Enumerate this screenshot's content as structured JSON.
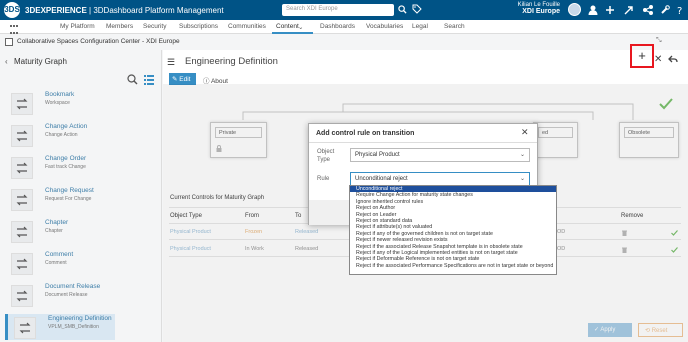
{
  "topbar": {
    "logo": "3DS",
    "brand_bold": "3DEXPERIENCE",
    "brand_rest": " | 3DDashboard  Platform Management",
    "search_placeholder": "Search XDI Europe",
    "user_name": "Kilian Le Fouille",
    "tenant": "XDI Europe"
  },
  "nav": {
    "items": [
      "My Platform",
      "Members",
      "Security",
      "Subscriptions",
      "Communities",
      "Content",
      "Dashboards",
      "Vocabularies",
      "Legal",
      "Search"
    ],
    "active": "Content"
  },
  "subheader": {
    "title": "Collaborative Spaces Configuration Center - XDI Europe"
  },
  "left": {
    "title": "Maturity Graph",
    "items": [
      {
        "name": "Bookmark",
        "desc": "Workspace"
      },
      {
        "name": "Change Action",
        "desc": "Change Action"
      },
      {
        "name": "Change Order",
        "desc": "Fast track Change"
      },
      {
        "name": "Change Request",
        "desc": "Request For Change"
      },
      {
        "name": "Chapter",
        "desc": "Chapter"
      },
      {
        "name": "Comment",
        "desc": "Comment"
      },
      {
        "name": "Document Release",
        "desc": "Document Release"
      },
      {
        "name": "Engineering Definition",
        "desc": "VPLM_SMB_Definition"
      }
    ]
  },
  "main": {
    "title": "Engineering Definition",
    "plus_label": "+",
    "close_label": "✕",
    "edit_label": "Edit",
    "about_label": "About",
    "nodes": {
      "private": "Private",
      "released": "ed",
      "obsolete": "Obsolete"
    },
    "controls_title": "Current Controls for Maturity Graph",
    "table": {
      "headers": [
        "Object Type",
        "From",
        "To",
        "Remove"
      ],
      "rows": [
        {
          "type": "Physical Product",
          "from": "Frozen",
          "to": "Released",
          "tail": "ROD"
        },
        {
          "type": "Physical Product",
          "from": "In Work",
          "to": "Released",
          "tail": "ROD"
        }
      ]
    },
    "apply_label": "Apply",
    "reset_label": "Reset"
  },
  "modal": {
    "title": "Add control rule on transition",
    "object_type_label": "Object Type",
    "object_type_value": "Physical Product",
    "rule_label": "Rule",
    "rule_value": "Unconditional reject",
    "options": [
      "Unconditional reject",
      "Require Change Action for maturity state changes",
      "Ignore inherited control rules",
      "Reject on Author",
      "Reject on Leader",
      "Reject on standard data",
      "Reject if attribute(s) not valuated",
      "Reject if any of the governed children is not on target state",
      "Reject if newer released revision exists",
      "Reject if the associated Release Snapshot template is in obsolete state",
      "Reject if any of the Logical implemented entities is not on target state",
      "Reject if Deformable Reference is not on target state",
      "Reject if the associated Performance Specifications are not in target state or beyond"
    ]
  },
  "colors": {
    "topbar": "#005386",
    "accent": "#368ec4",
    "highlight": "#e8171f",
    "selected_option": "#1e4f9c"
  }
}
